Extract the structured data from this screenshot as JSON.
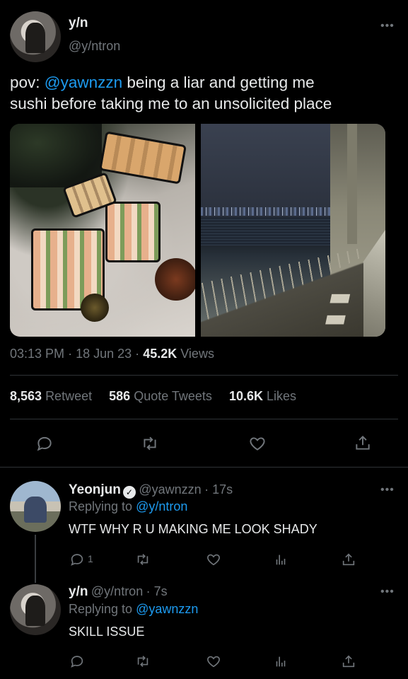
{
  "tweet": {
    "author_name": "y/n",
    "author_handle": "@y/ntron",
    "more_icon": "more-horizontal-icon",
    "text_prefix": "pov: ",
    "text_mention": "@yawnzzn",
    "text_suffix_line1": " being a liar and getting me",
    "text_line2": "sushi before taking me to an unsolicited place",
    "time": "03:13 PM",
    "date": "18 Jun 23",
    "views_count": "45.2K",
    "views_label": "Views",
    "separator": "·",
    "stats": {
      "retweets_count": "8,563",
      "retweets_label": "Retweet",
      "quotes_count": "586",
      "quotes_label": "Quote Tweets",
      "likes_count": "10.6K",
      "likes_label": "Likes"
    },
    "actions": [
      "reply-icon",
      "retweet-icon",
      "like-icon",
      "share-icon"
    ]
  },
  "replies": [
    {
      "author_name": "Yeonjun",
      "verified": true,
      "author_handle": "@yawnzzn",
      "time": "· 17s",
      "replying_label": "Replying to",
      "replying_to": "@y/ntron",
      "text": "WTF WHY R U MAKING ME LOOK SHADY",
      "reply_count": "1"
    },
    {
      "author_name": "y/n",
      "verified": false,
      "author_handle": "@y/ntron",
      "time": "· 7s",
      "replying_label": "Replying to",
      "replying_to": "@yawnzzn",
      "text": "SKILL ISSUE",
      "reply_count": ""
    }
  ],
  "colors": {
    "background": "#000000",
    "text": "#e7e9ea",
    "muted": "#71767b",
    "link": "#1d9bf0",
    "divider": "#2f3336"
  }
}
